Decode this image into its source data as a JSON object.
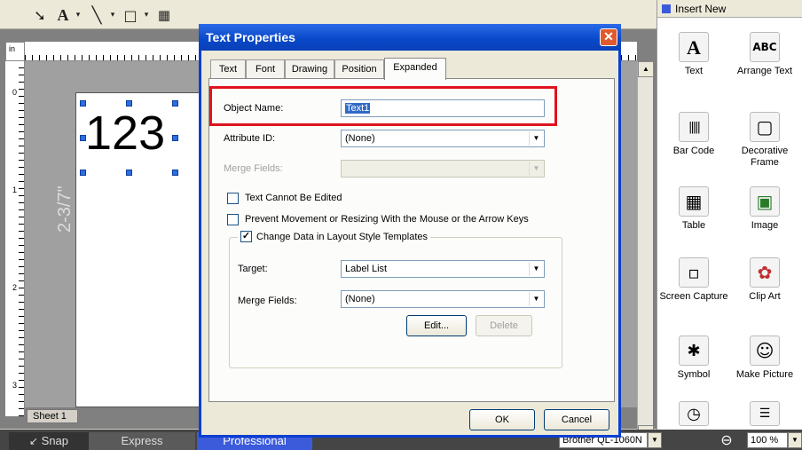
{
  "toolbar": {
    "icons": [
      "select-arrow-icon",
      "text-tool-icon",
      "line-tool-icon",
      "rectangle-tool-icon",
      "table-tool-icon"
    ]
  },
  "ruler": {
    "unit": "in",
    "v_marks": [
      "0",
      "1",
      "2",
      "3"
    ]
  },
  "canvas": {
    "object_text": "123",
    "vertical_label": "2-3/7\"",
    "sheet_tab": "Sheet 1"
  },
  "bottombar": {
    "tabs": [
      "Snap",
      "Express",
      "Professional"
    ],
    "printer": "Brother QL-1060N",
    "zoom": "100 %"
  },
  "panel": {
    "header": "Insert New",
    "items": [
      {
        "label": "Text",
        "icon": "text-icon",
        "glyph": "A"
      },
      {
        "label": "Arrange Text",
        "icon": "arrange-text-icon",
        "glyph": "ABC"
      },
      {
        "label": "Bar Code",
        "icon": "barcode-icon",
        "glyph": "|||||"
      },
      {
        "label": "Decorative Frame",
        "icon": "decorative-frame-icon",
        "glyph": "▢"
      },
      {
        "label": "Table",
        "icon": "table-icon",
        "glyph": "▦"
      },
      {
        "label": "Image",
        "icon": "image-icon",
        "glyph": "▣"
      },
      {
        "label": "Screen Capture",
        "icon": "screen-capture-icon",
        "glyph": "▫"
      },
      {
        "label": "Clip Art",
        "icon": "clip-art-icon",
        "glyph": "✿"
      },
      {
        "label": "Symbol",
        "icon": "symbol-icon",
        "glyph": "✱"
      },
      {
        "label": "Make Picture",
        "icon": "make-picture-icon",
        "glyph": "☺"
      }
    ]
  },
  "dialog": {
    "title": "Text Properties",
    "tabs": [
      "Text",
      "Font",
      "Drawing",
      "Position",
      "Expanded"
    ],
    "active_tab": "Expanded",
    "object_name_label": "Object Name:",
    "object_name_value": "Text1",
    "attribute_id_label": "Attribute ID:",
    "attribute_id_value": "(None)",
    "merge_fields_label": "Merge Fields:",
    "merge_fields_value": "",
    "cannot_edit_label": "Text Cannot Be Edited",
    "prevent_move_label": "Prevent Movement or Resizing With the Mouse or the Arrow Keys",
    "change_data_label": "Change Data in Layout Style Templates",
    "change_data_checked": true,
    "target_label": "Target:",
    "target_value": "Label List",
    "group_merge_label": "Merge Fields:",
    "group_merge_value": "(None)",
    "edit_button": "Edit...",
    "delete_button": "Delete",
    "ok_button": "OK",
    "cancel_button": "Cancel"
  },
  "colors": {
    "highlight": "#e0141e",
    "titlebar": "#0848c8",
    "selection": "#316ac5"
  }
}
